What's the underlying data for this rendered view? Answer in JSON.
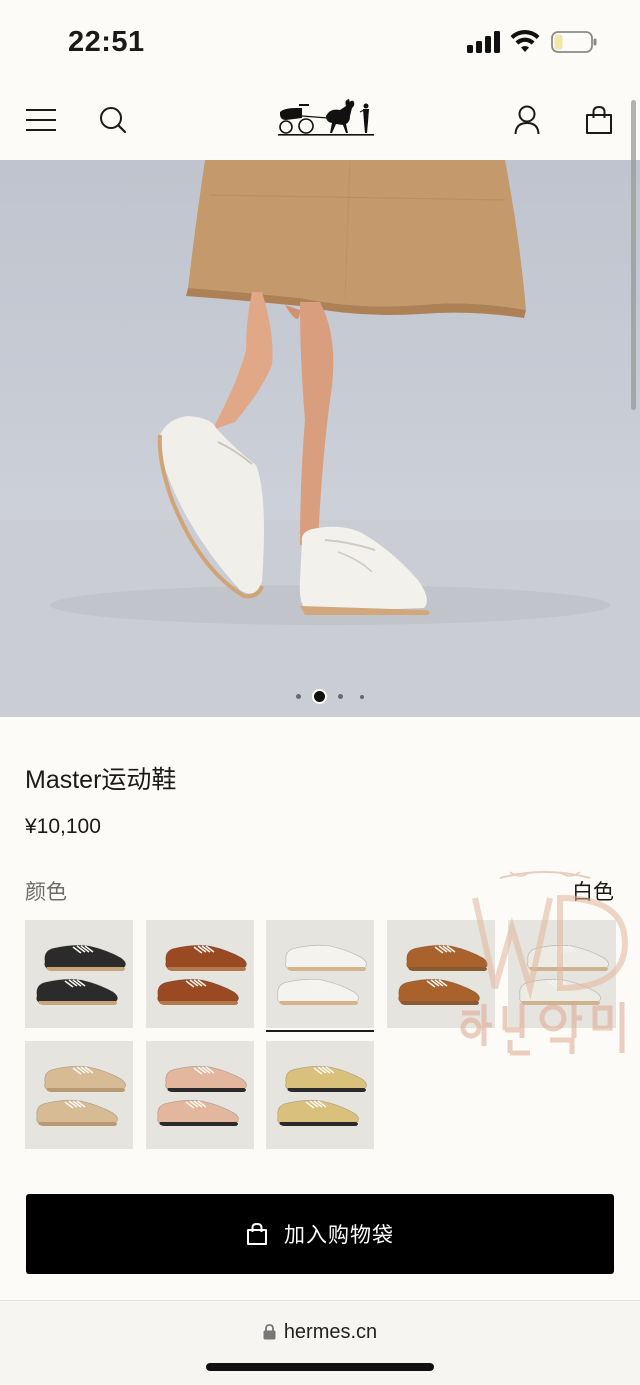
{
  "status_bar": {
    "time": "22:51"
  },
  "nav": {
    "menu_icon": "menu-icon",
    "search_icon": "search-icon",
    "logo": "hermes-carriage-logo",
    "account_icon": "user-icon",
    "bag_icon": "shopping-bag-icon"
  },
  "carousel": {
    "total_slides": 4,
    "active_index": 1
  },
  "product": {
    "title": "Master运动鞋",
    "price": "¥10,100",
    "color_label": "颜色",
    "selected_color": "白色"
  },
  "swatches": [
    {
      "name": "black",
      "shoe": "#2b2b2b",
      "sole": "#c9a57a"
    },
    {
      "name": "brown",
      "shoe": "#9a4a22",
      "sole": "#b07a4c"
    },
    {
      "name": "white",
      "shoe": "#f4f3ef",
      "sole": "#d6b38b",
      "selected": true
    },
    {
      "name": "tan",
      "shoe": "#a9622c",
      "sole": "#8a5a35"
    },
    {
      "name": "off-white",
      "shoe": "#ecebe4",
      "sole": "#cdb38f"
    },
    {
      "name": "beige",
      "shoe": "#d7bb94",
      "sole": "#b99a72"
    },
    {
      "name": "pink",
      "shoe": "#e3b69e",
      "sole": "#2a2a2a"
    },
    {
      "name": "yellow",
      "shoe": "#d9c07b",
      "sole": "#2a2a2a"
    }
  ],
  "cart": {
    "label": "加入购物袋",
    "icon": "shopping-bag-icon"
  },
  "browser": {
    "url": "hermes.cn",
    "icon": "lock-icon"
  },
  "watermark": {
    "letters": "WD",
    "korean": "하얀악마"
  }
}
